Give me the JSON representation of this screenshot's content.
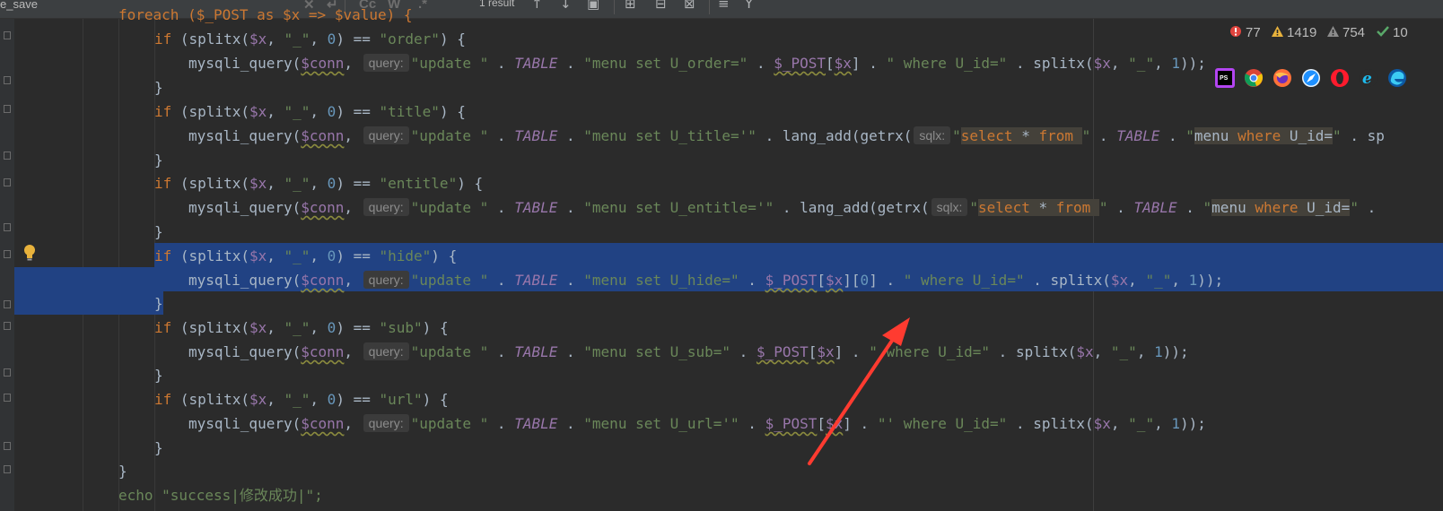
{
  "toolbar": {
    "search_field": "e_save",
    "case_label": "Cc",
    "word_label": "W",
    "regex_label": ".*",
    "result_count": "1 result"
  },
  "inspections": {
    "errors": "77",
    "warnings": "1419",
    "weak_warnings": "754",
    "ok": "10"
  },
  "browsers": [
    "phpstorm-icon",
    "chrome-icon",
    "firefox-icon",
    "safari-icon",
    "opera-icon",
    "ie-icon",
    "edge-icon"
  ],
  "code": {
    "line0": "foreach ($_POST as $x => $value) {",
    "if_order": "order",
    "if_title": "title",
    "if_entitle": "entitle",
    "if_hide": "hide",
    "if_sub": "sub",
    "if_url": "url",
    "echo": "echo \"success|修改成功|\";"
  },
  "colors": {
    "background": "#2b2b2b",
    "selection": "#214283",
    "keyword": "#cc7832",
    "string": "#6a8759",
    "variable": "#9876aa",
    "number": "#6897bb",
    "arrow": "#ff3b30"
  }
}
